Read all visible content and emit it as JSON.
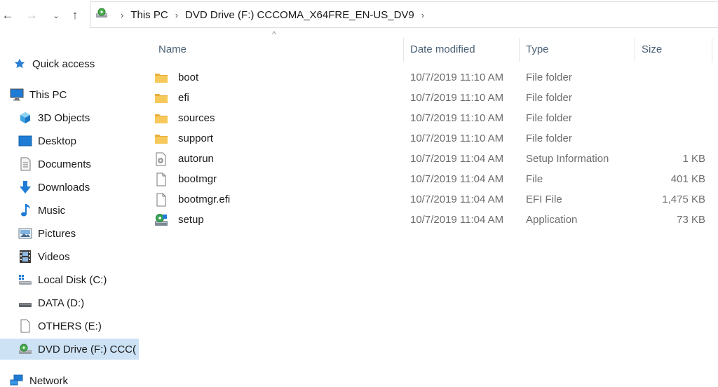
{
  "navigation": {
    "back": "←",
    "forward": "→",
    "recent": "⌄",
    "up": "↑"
  },
  "address": {
    "crumbs": [
      "This PC",
      "DVD Drive (F:) CCCOMA_X64FRE_EN-US_DV9"
    ],
    "separator": "›"
  },
  "sidebar": {
    "items": [
      {
        "label": "Quick access",
        "icon": "star-icon"
      },
      {
        "label": "This PC",
        "icon": "computer-icon"
      },
      {
        "label": "3D Objects",
        "icon": "cube-icon"
      },
      {
        "label": "Desktop",
        "icon": "desktop-icon"
      },
      {
        "label": "Documents",
        "icon": "documents-icon"
      },
      {
        "label": "Downloads",
        "icon": "download-arrow-icon"
      },
      {
        "label": "Music",
        "icon": "music-note-icon"
      },
      {
        "label": "Pictures",
        "icon": "pictures-icon"
      },
      {
        "label": "Videos",
        "icon": "film-icon"
      },
      {
        "label": "Local Disk (C:)",
        "icon": "windows-drive-icon"
      },
      {
        "label": "DATA (D:)",
        "icon": "drive-icon"
      },
      {
        "label": "OTHERS (E:)",
        "icon": "blank-drive-icon"
      },
      {
        "label": "DVD Drive (F:) CCC(",
        "icon": "dvd-drive-icon"
      },
      {
        "label": "Network",
        "icon": "network-icon"
      }
    ]
  },
  "columns": {
    "name": "Name",
    "date": "Date modified",
    "type": "Type",
    "size": "Size",
    "sort_indicator": "^"
  },
  "files": [
    {
      "name": "boot",
      "date": "10/7/2019 11:10 AM",
      "type": "File folder",
      "size": "",
      "icon": "folder-icon"
    },
    {
      "name": "efi",
      "date": "10/7/2019 11:10 AM",
      "type": "File folder",
      "size": "",
      "icon": "folder-icon"
    },
    {
      "name": "sources",
      "date": "10/7/2019 11:10 AM",
      "type": "File folder",
      "size": "",
      "icon": "folder-icon"
    },
    {
      "name": "support",
      "date": "10/7/2019 11:10 AM",
      "type": "File folder",
      "size": "",
      "icon": "folder-icon"
    },
    {
      "name": "autorun",
      "date": "10/7/2019 11:04 AM",
      "type": "Setup Information",
      "size": "1 KB",
      "icon": "settings-file-icon"
    },
    {
      "name": "bootmgr",
      "date": "10/7/2019 11:04 AM",
      "type": "File",
      "size": "401 KB",
      "icon": "blank-file-icon"
    },
    {
      "name": "bootmgr.efi",
      "date": "10/7/2019 11:04 AM",
      "type": "EFI File",
      "size": "1,475 KB",
      "icon": "blank-file-icon"
    },
    {
      "name": "setup",
      "date": "10/7/2019 11:04 AM",
      "type": "Application",
      "size": "73 KB",
      "icon": "setup-app-icon"
    }
  ],
  "colors": {
    "selection": "#cde2f5",
    "folder": "#f7c85a",
    "accent": "#1e7bd6"
  }
}
